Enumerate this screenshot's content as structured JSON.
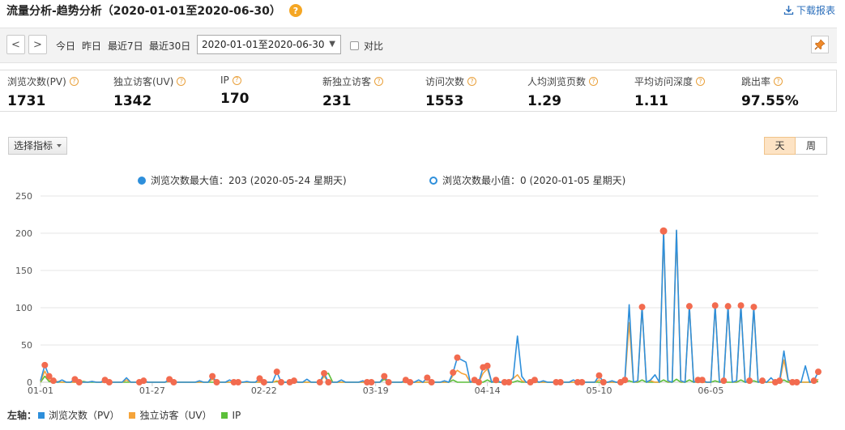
{
  "header": {
    "title": "流量分析-趋势分析（2020-01-01至2020-06-30）",
    "help": "?",
    "download_label": "下载报表"
  },
  "toolbar": {
    "prev": "<",
    "next": ">",
    "quick": [
      "今日",
      "昨日",
      "最近7日",
      "最近30日"
    ],
    "date_range": "2020-01-01至2020-06-30",
    "compare_label": "对比"
  },
  "metrics": [
    {
      "label": "浏览次数(PV)",
      "value": "1731"
    },
    {
      "label": "独立访客(UV)",
      "value": "1342"
    },
    {
      "label": "IP",
      "value": "170"
    },
    {
      "label": "新独立访客",
      "value": "231"
    },
    {
      "label": "访问次数",
      "value": "1553"
    },
    {
      "label": "人均浏览页数",
      "value": "1.29"
    },
    {
      "label": "平均访问深度",
      "value": "1.11"
    },
    {
      "label": "跳出率",
      "value": "97.55%"
    }
  ],
  "controls": {
    "select_metric": "选择指标",
    "period_day": "天",
    "period_week": "周"
  },
  "annotations": {
    "max_label": "浏览次数最大值：203 (2020-05-24 星期天)",
    "min_label": "浏览次数最小值：0 (2020-01-05 星期天)"
  },
  "legend": {
    "axis_label": "左轴：",
    "items": [
      "浏览次数（PV）",
      "独立访客（UV）",
      "IP"
    ]
  },
  "colors": {
    "pv": "#2e8fdb",
    "uv": "#f5a43a",
    "ip": "#5cbf3a",
    "marker": "#f26b4f"
  },
  "chart_data": {
    "type": "line",
    "ylim": [
      0,
      250
    ],
    "yticks": [
      0,
      50,
      100,
      150,
      200,
      250
    ],
    "xtick_labels": [
      "01-01",
      "01-27",
      "02-22",
      "03-19",
      "04-14",
      "05-10",
      "06-05"
    ],
    "xtick_index": [
      0,
      26,
      52,
      78,
      104,
      130,
      156
    ],
    "num_points": 182,
    "series": [
      {
        "name": "浏览次数（PV）",
        "points": [
          [
            0,
            2
          ],
          [
            1,
            23
          ],
          [
            2,
            8
          ],
          [
            3,
            2
          ],
          [
            5,
            3
          ],
          [
            8,
            4
          ],
          [
            12,
            1
          ],
          [
            15,
            3
          ],
          [
            20,
            6
          ],
          [
            24,
            2
          ],
          [
            30,
            4
          ],
          [
            37,
            2
          ],
          [
            40,
            8
          ],
          [
            44,
            3
          ],
          [
            48,
            1
          ],
          [
            51,
            5
          ],
          [
            55,
            14
          ],
          [
            59,
            2
          ],
          [
            62,
            4
          ],
          [
            66,
            12
          ],
          [
            70,
            3
          ],
          [
            75,
            2
          ],
          [
            80,
            8
          ],
          [
            85,
            3
          ],
          [
            88,
            3
          ],
          [
            90,
            6
          ],
          [
            94,
            2
          ],
          [
            96,
            13
          ],
          [
            97,
            33
          ],
          [
            98,
            30
          ],
          [
            99,
            27
          ],
          [
            101,
            3
          ],
          [
            103,
            20
          ],
          [
            104,
            22
          ],
          [
            106,
            3
          ],
          [
            110,
            6
          ],
          [
            111,
            62
          ],
          [
            112,
            8
          ],
          [
            115,
            3
          ],
          [
            117,
            2
          ],
          [
            124,
            3
          ],
          [
            130,
            9
          ],
          [
            133,
            2
          ],
          [
            136,
            3
          ],
          [
            137,
            104
          ],
          [
            139,
            2
          ],
          [
            140,
            101
          ],
          [
            142,
            3
          ],
          [
            143,
            10
          ],
          [
            145,
            203
          ],
          [
            146,
            2
          ],
          [
            148,
            204
          ],
          [
            149,
            2
          ],
          [
            151,
            102
          ],
          [
            153,
            3
          ],
          [
            154,
            3
          ],
          [
            157,
            103
          ],
          [
            159,
            2
          ],
          [
            160,
            102
          ],
          [
            162,
            2
          ],
          [
            163,
            103
          ],
          [
            165,
            2
          ],
          [
            166,
            101
          ],
          [
            168,
            2
          ],
          [
            170,
            6
          ],
          [
            172,
            2
          ],
          [
            173,
            42
          ],
          [
            174,
            3
          ],
          [
            178,
            22
          ],
          [
            180,
            2
          ],
          [
            181,
            14
          ]
        ]
      },
      {
        "name": "独立访客（UV）",
        "points": [
          [
            0,
            1
          ],
          [
            1,
            15
          ],
          [
            2,
            3
          ],
          [
            4,
            1
          ],
          [
            12,
            1
          ],
          [
            20,
            3
          ],
          [
            30,
            2
          ],
          [
            40,
            4
          ],
          [
            55,
            2
          ],
          [
            66,
            8
          ],
          [
            80,
            7
          ],
          [
            85,
            2
          ],
          [
            96,
            9
          ],
          [
            97,
            16
          ],
          [
            98,
            12
          ],
          [
            99,
            10
          ],
          [
            101,
            2
          ],
          [
            103,
            12
          ],
          [
            104,
            18
          ],
          [
            106,
            2
          ],
          [
            110,
            5
          ],
          [
            111,
            10
          ],
          [
            112,
            2
          ],
          [
            130,
            3
          ],
          [
            136,
            2
          ],
          [
            137,
            80
          ],
          [
            139,
            1
          ],
          [
            140,
            100
          ],
          [
            142,
            2
          ],
          [
            145,
            202
          ],
          [
            146,
            1
          ],
          [
            148,
            203
          ],
          [
            149,
            1
          ],
          [
            151,
            102
          ],
          [
            153,
            1
          ],
          [
            157,
            102
          ],
          [
            159,
            1
          ],
          [
            160,
            101
          ],
          [
            162,
            1
          ],
          [
            163,
            102
          ],
          [
            165,
            1
          ],
          [
            166,
            100
          ],
          [
            168,
            2
          ],
          [
            173,
            30
          ],
          [
            174,
            2
          ],
          [
            181,
            4
          ]
        ]
      },
      {
        "name": "IP",
        "points": [
          [
            0,
            0
          ],
          [
            1,
            8
          ],
          [
            2,
            1
          ],
          [
            10,
            1
          ],
          [
            30,
            1
          ],
          [
            55,
            1
          ],
          [
            66,
            10
          ],
          [
            67,
            12
          ],
          [
            80,
            4
          ],
          [
            96,
            3
          ],
          [
            104,
            3
          ],
          [
            111,
            2
          ],
          [
            137,
            2
          ],
          [
            140,
            3
          ],
          [
            145,
            3
          ],
          [
            148,
            4
          ],
          [
            151,
            3
          ],
          [
            157,
            2
          ],
          [
            163,
            3
          ],
          [
            166,
            2
          ],
          [
            173,
            3
          ],
          [
            181,
            1
          ]
        ]
      }
    ],
    "marker_days": [
      1,
      2,
      3,
      8,
      9,
      15,
      16,
      23,
      24,
      30,
      31,
      40,
      41,
      45,
      46,
      51,
      52,
      55,
      56,
      58,
      59,
      65,
      66,
      67,
      76,
      77,
      80,
      81,
      85,
      86,
      90,
      91,
      96,
      97,
      101,
      102,
      103,
      104,
      106,
      108,
      109,
      114,
      115,
      120,
      121,
      125,
      126,
      130,
      131,
      135,
      136,
      140,
      145,
      151,
      153,
      154,
      157,
      159,
      160,
      163,
      165,
      166,
      168,
      171,
      172,
      175,
      176,
      180,
      181
    ],
    "max_point": [
      145,
      203
    ],
    "min_point": [
      4,
      0
    ]
  }
}
